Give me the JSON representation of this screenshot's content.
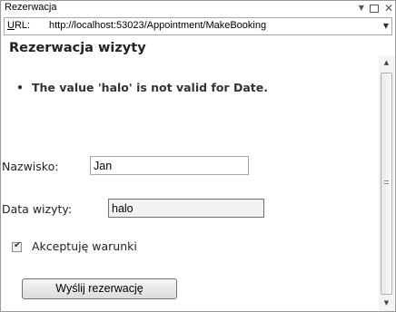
{
  "window": {
    "title": "Rezerwacja",
    "controls": {
      "pin": "▼",
      "restore": "",
      "close": "✕"
    }
  },
  "addressbar": {
    "label_underlined": "U",
    "label_rest": "RL:",
    "url": "http://localhost:53023/Appointment/MakeBooking",
    "dropdown": "▼"
  },
  "page": {
    "title": "Rezerwacja wizyty",
    "errors": [
      "The value 'halo' is not valid for Date."
    ],
    "form": {
      "name_label": "Nazwisko:",
      "name_value": "Jan",
      "date_label": "Data wizyty:",
      "date_value": "halo",
      "terms_label": "Akceptuję warunki",
      "terms_checked": true,
      "submit_label": "Wyślij rezerwację"
    }
  },
  "scrollbar": {
    "up": "▲",
    "down": "▼"
  }
}
